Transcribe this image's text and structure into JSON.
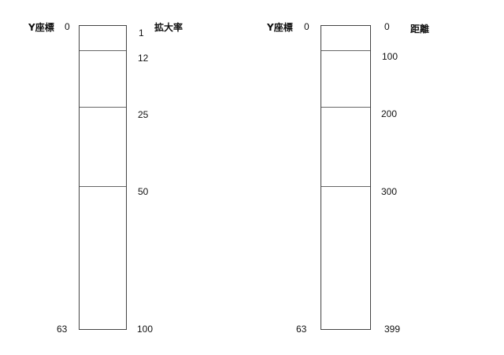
{
  "diagrams": [
    {
      "left_heading": "Y座標",
      "right_heading": "拡大率",
      "top_y_label": "0",
      "bottom_y_label": "63",
      "scale_labels": [
        "1",
        "12",
        "25",
        "50",
        "100"
      ]
    },
    {
      "left_heading": "Y座標",
      "right_heading": "距離",
      "top_y_label": "0",
      "bottom_y_label": "63",
      "scale_labels": [
        "0",
        "100",
        "200",
        "300",
        "399"
      ]
    }
  ]
}
